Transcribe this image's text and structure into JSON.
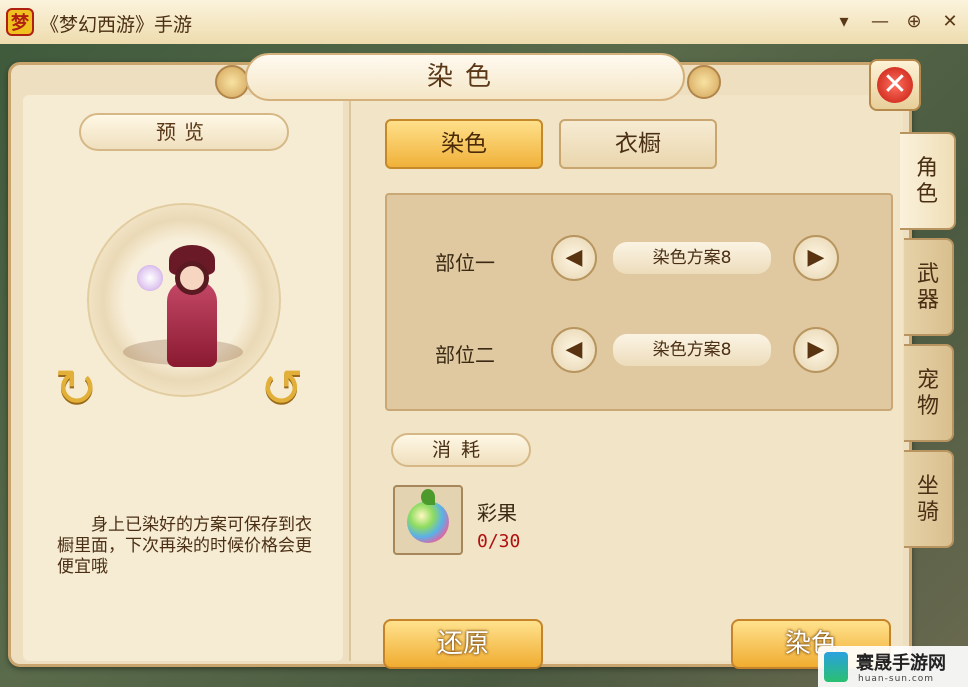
{
  "window": {
    "title": "《梦幻西游》手游",
    "logo_glyph": "梦",
    "menu_glyph": "▾",
    "minimize_glyph": "—",
    "maximize_glyph": "⊕",
    "close_glyph": "✕"
  },
  "panel": {
    "title": "染色",
    "close_glyph": "✕"
  },
  "side_tabs": [
    {
      "label": "角色",
      "active": true
    },
    {
      "label": "武器",
      "active": false
    },
    {
      "label": "宠物",
      "active": false
    },
    {
      "label": "坐骑",
      "active": false
    }
  ],
  "preview": {
    "label": "预览",
    "rotate_left_glyph": "↻",
    "rotate_right_glyph": "↺",
    "description": "身上已染好的方案可保存到衣橱里面，下次再染的时候价格会更便宜哦"
  },
  "tabs": [
    {
      "label": "染色",
      "active": true
    },
    {
      "label": "衣橱",
      "active": false
    }
  ],
  "parts": [
    {
      "label": "部位一",
      "scheme": "染色方案8"
    },
    {
      "label": "部位二",
      "scheme": "染色方案8"
    }
  ],
  "arrows": {
    "prev": "◀",
    "next": "▶"
  },
  "cost": {
    "label": "消耗",
    "item_name": "彩果",
    "item_count": "0/30"
  },
  "buttons": {
    "reset": "还原",
    "dye": "染色"
  },
  "watermark": {
    "name": "寰晟手游网",
    "url": "huan-sun.com"
  },
  "colors": {
    "accent_gold": "#f0ac30",
    "panel_bg": "#eedfc1",
    "count_red": "#b01010"
  }
}
